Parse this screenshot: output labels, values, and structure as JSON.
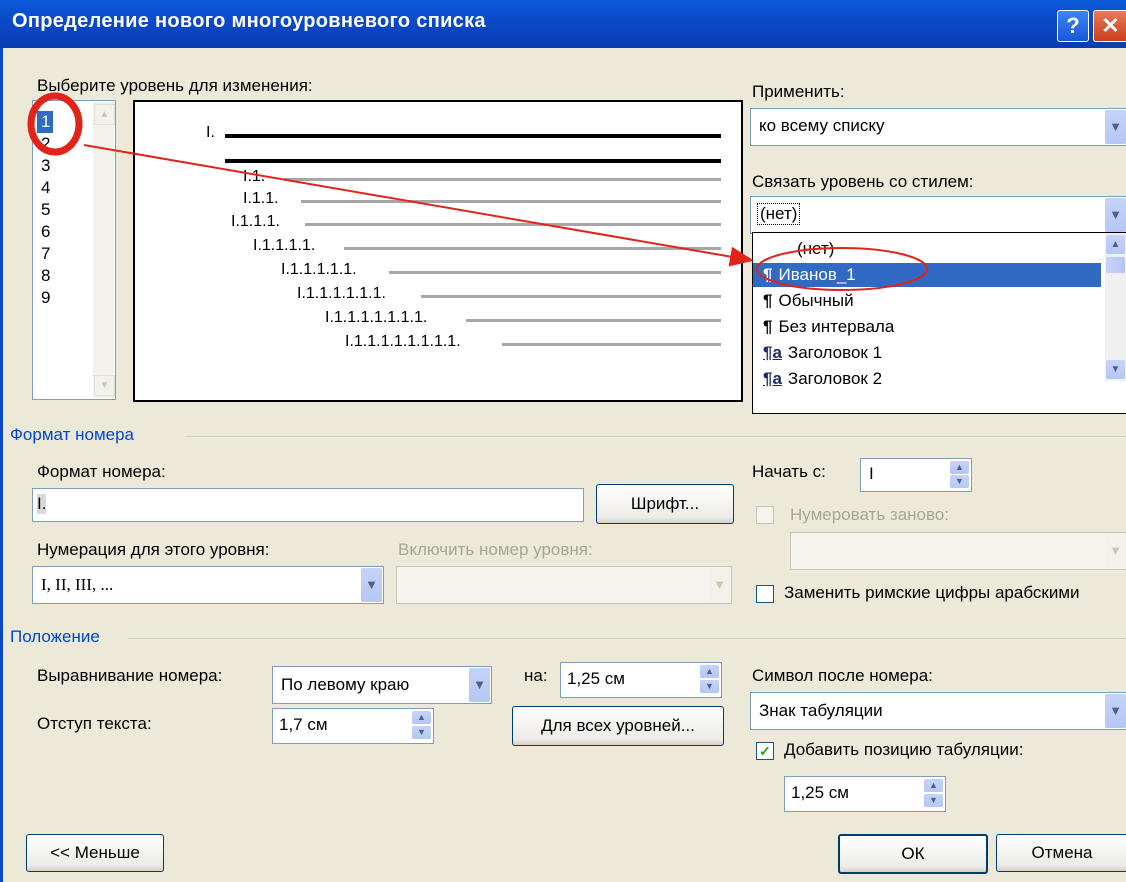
{
  "window": {
    "title": "Определение нового многоуровневого списка"
  },
  "levels": {
    "label": "Выберите уровень для изменения:",
    "items": [
      "1",
      "2",
      "3",
      "4",
      "5",
      "6",
      "7",
      "8",
      "9"
    ],
    "selected": "1"
  },
  "preview": {
    "main_label": "I.",
    "sub_labels": [
      "I.1.",
      "I.1.1.",
      "I.1.1.1.",
      "I.1.1.1.1.",
      "I.1.1.1.1.1.",
      "I.1.1.1.1.1.1.",
      "I.1.1.1.1.1.1.1.",
      "I.1.1.1.1.1.1.1.1."
    ]
  },
  "apply": {
    "label": "Применить:",
    "value": "ко всему списку"
  },
  "link_style": {
    "label": "Связать уровень со стилем:",
    "value": "(нет)",
    "options": [
      {
        "icon": "",
        "label": "(нет)"
      },
      {
        "icon": "¶",
        "label": "Иванов_1"
      },
      {
        "icon": "¶",
        "label": "Обычный"
      },
      {
        "icon": "¶",
        "label": "Без интервала"
      },
      {
        "icon": "¶a",
        "label": "Заголовок 1"
      },
      {
        "icon": "¶a",
        "label": "Заголовок 2"
      }
    ],
    "highlighted": "Иванов_1"
  },
  "number_format": {
    "section_title": "Формат номера",
    "format_label": "Формат номера:",
    "format_value": "I.",
    "font_button": "Шрифт...",
    "numbering_label": "Нумерация для этого уровня:",
    "numbering_value": "I, II, III, ...",
    "include_level_label": "Включить номер уровня:",
    "start_at_label": "Начать с:",
    "start_at_value": "I",
    "restart_label": "Нумеровать заново:",
    "legal_label": "Заменить римские цифры арабскими"
  },
  "position": {
    "section_title": "Положение",
    "alignment_label": "Выравнивание номера:",
    "alignment_value": "По левому краю",
    "at_label": "на:",
    "at_value": "1,25 см",
    "indent_label": "Отступ текста:",
    "indent_value": "1,7 см",
    "all_levels_button": "Для всех уровней...",
    "after_number_label": "Символ после номера:",
    "after_number_value": "Знак табуляции",
    "add_tab_label": "Добавить позицию табуляции:",
    "add_tab_checked": true,
    "tab_value": "1,25 см"
  },
  "buttons": {
    "less": "<< Меньше",
    "ok": "ОК",
    "cancel": "Отмена"
  },
  "colors": {
    "annotation": "#E2231A",
    "titlebar": "#0A48C8",
    "selection": "#316AC5"
  }
}
